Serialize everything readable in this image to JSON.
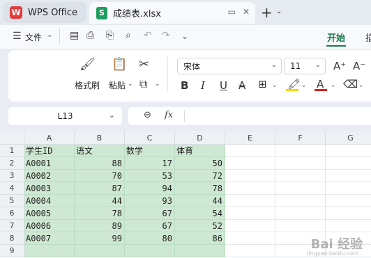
{
  "tabs": {
    "home": {
      "label": "WPS Office"
    },
    "file": {
      "label": "成绩表.xlsx"
    }
  },
  "menu": {
    "file_label": "文件",
    "active_tab": "开始",
    "next_tab": "插"
  },
  "ribbon": {
    "format_painter": "格式刷",
    "paste": "粘贴",
    "font_name": "宋体",
    "font_size": "11"
  },
  "formula_bar": {
    "cell_ref": "L13",
    "fx": "fx",
    "value": ""
  },
  "sheet": {
    "columns": [
      "A",
      "B",
      "C",
      "D",
      "E",
      "F",
      "G"
    ],
    "rows": [
      "1",
      "2",
      "3",
      "4",
      "5",
      "6",
      "7",
      "8",
      "9"
    ],
    "cells": [
      [
        "学生ID",
        "语文",
        "数学",
        "体育"
      ],
      [
        "A0001",
        "88",
        "17",
        "50"
      ],
      [
        "A0002",
        "70",
        "53",
        "72"
      ],
      [
        "A0003",
        "87",
        "94",
        "78"
      ],
      [
        "A0004",
        "44",
        "93",
        "44"
      ],
      [
        "A0005",
        "78",
        "67",
        "54"
      ],
      [
        "A0006",
        "89",
        "67",
        "52"
      ],
      [
        "A0007",
        "99",
        "80",
        "86"
      ]
    ],
    "highlight_color": "#cfe8d3"
  },
  "watermark": {
    "text": "Bai 经验",
    "url": "jingyan.baidu.com"
  },
  "colors": {
    "accent": "#1b7a4b",
    "wps_red": "#e33a3a",
    "sheet_green": "#1f9d5f"
  }
}
